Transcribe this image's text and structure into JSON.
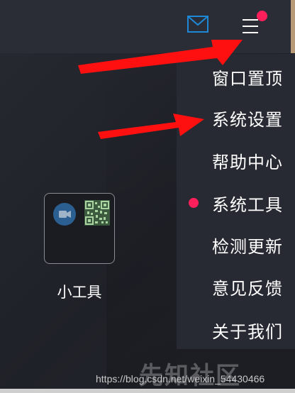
{
  "menu": {
    "items": [
      {
        "label": "窗口置顶",
        "active": false
      },
      {
        "label": "系统设置",
        "active": false
      },
      {
        "label": "帮助中心",
        "active": false
      },
      {
        "label": "系统工具",
        "active": true
      },
      {
        "label": "检测更新",
        "active": false
      },
      {
        "label": "意见反馈",
        "active": false
      },
      {
        "label": "关于我们",
        "active": false
      }
    ]
  },
  "desktop": {
    "tile_label": "小工具"
  },
  "watermark": {
    "url": "https://blog.csdn.net/weixin_54430466",
    "brand": "先知社区"
  },
  "colors": {
    "accent": "#ff1f5a",
    "arrow": "#ff1010",
    "mail_icon": "#1e88d6"
  },
  "icons": [
    "mail-icon",
    "hamburger-menu-icon",
    "video-camera-icon",
    "qr-code-icon"
  ]
}
